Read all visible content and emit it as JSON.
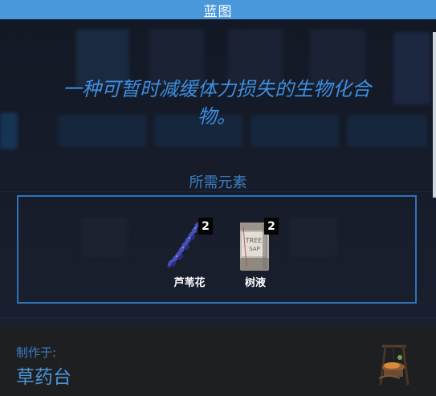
{
  "title": "蓝图",
  "description": "一种可暂时减缓体力损失的生物化合物。",
  "requirements": {
    "title": "所需元素",
    "items": [
      {
        "name": "芦苇花",
        "count": "2",
        "icon": "reed-flower-icon"
      },
      {
        "name": "树液",
        "count": "2",
        "icon": "tree-sap-jar-icon"
      }
    ]
  },
  "crafted_at": {
    "label": "制作于:",
    "station": "草药台",
    "icon": "herb-table-icon"
  },
  "colors": {
    "title_bar": "#4a98dc",
    "accent_text": "#3e8fe0",
    "box_border": "#2f74b8",
    "footer_bg": "#1e1f21"
  }
}
